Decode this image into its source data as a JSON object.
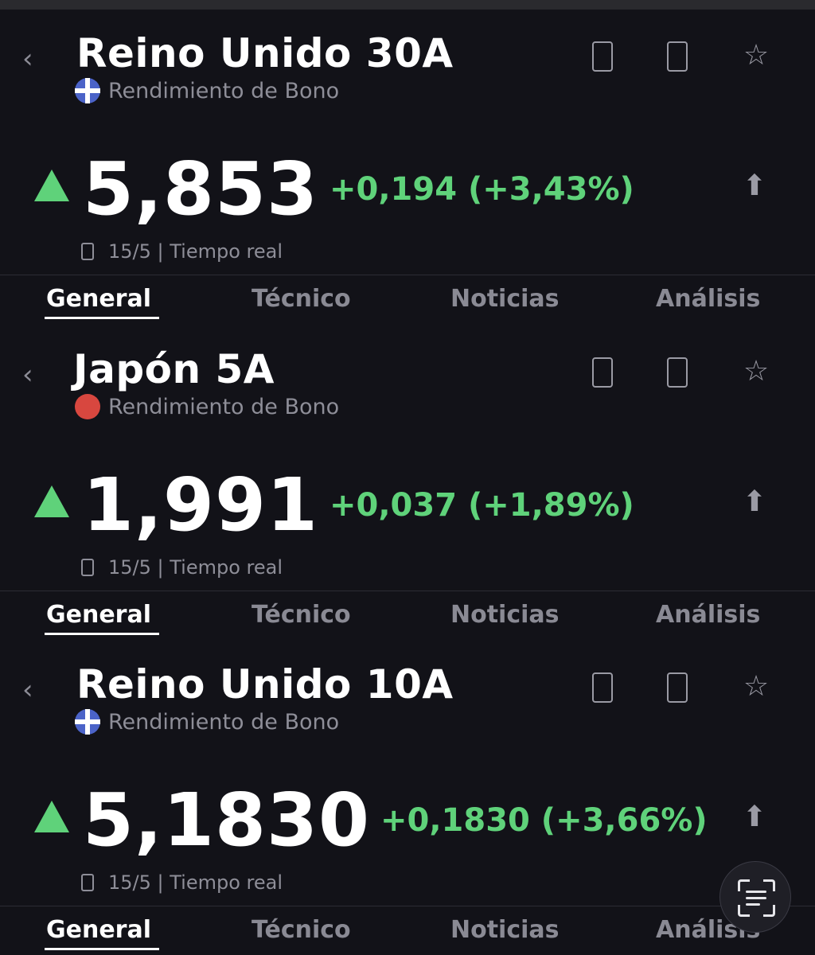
{
  "panels": [
    {
      "title": "Reino Unido 30A",
      "subtitle": "Rendimiento de Bono",
      "price": "5,853",
      "change": "+0,194 (+3,43%)",
      "time": "15/5 | Tiempo real",
      "tabs": [
        "General",
        "Técnico",
        "Noticias",
        "Análisis"
      ],
      "active_tab": "General"
    },
    {
      "title": "Japón 5A",
      "subtitle": "Rendimiento de Bono",
      "price": "1,991",
      "change": "+0,037 (+1,89%)",
      "time": "15/5 | Tiempo real",
      "tabs": [
        "General",
        "Técnico",
        "Noticias",
        "Análisis"
      ],
      "active_tab": "General"
    },
    {
      "title": "Reino Unido 10A",
      "subtitle": "Rendimiento de Bono",
      "price": "5,1830",
      "change": "+0,1830 (+3,66%)",
      "time": "15/5 | Tiempo real",
      "tabs": [
        "General",
        "Técnico",
        "Noticias",
        "Análisis"
      ],
      "active_tab": "General"
    }
  ],
  "icons": {
    "back": "chevron-left-icon",
    "bell": "bell-icon",
    "note": "note-icon",
    "star": "star-icon",
    "trend": "up-arrow-icon",
    "share": "share-icon",
    "clock": "clock-icon",
    "scan": "text-scan-icon"
  },
  "colors": {
    "background": "#121218",
    "positive": "#5fd27a",
    "muted": "#8e8e98",
    "flag_uk": "#4b63c8",
    "flag_jp": "#d8473f"
  }
}
